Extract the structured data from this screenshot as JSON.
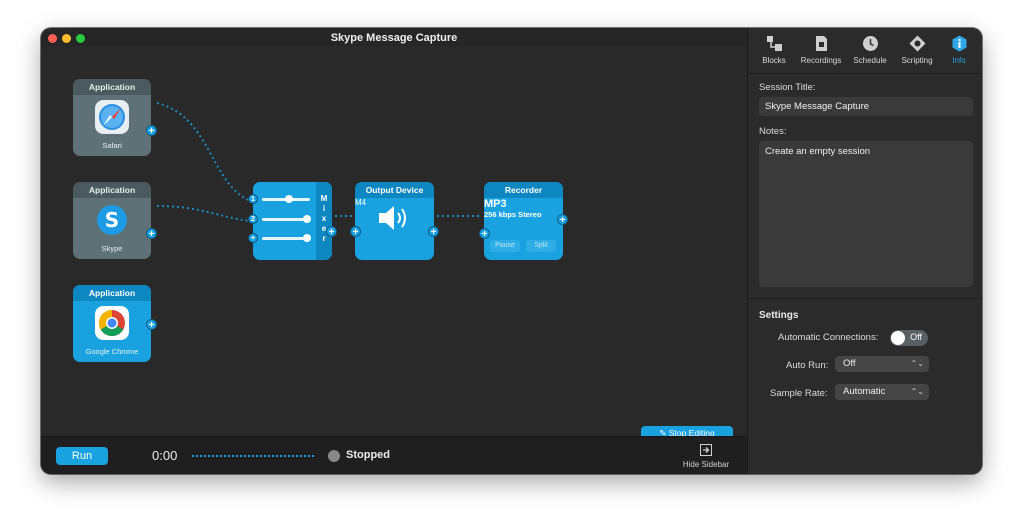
{
  "window": {
    "title": "Skype Message Capture"
  },
  "canvas": {
    "sources": [
      {
        "header": "Application",
        "name": "Safari",
        "icon": "safari-icon"
      },
      {
        "header": "Application",
        "name": "Skype",
        "icon": "skype-icon"
      },
      {
        "header": "Application",
        "name": "Google Chrome",
        "icon": "chrome-icon"
      }
    ],
    "mixer": {
      "letters": [
        "M",
        "i",
        "x",
        "e",
        "r"
      ],
      "inputs": [
        "1",
        "2",
        "+"
      ]
    },
    "output": {
      "header": "Output Device",
      "name": "M4",
      "icon": "speaker-icon"
    },
    "recorder": {
      "header": "Recorder",
      "format": "MP3",
      "quality": "256 kbps Stereo",
      "pause_label": "Pause",
      "split_label": "Split"
    },
    "stop_editing_label": "Stop Editing"
  },
  "bottom": {
    "run_label": "Run",
    "time": "0:00",
    "status": "Stopped",
    "hide_sidebar_label": "Hide Sidebar"
  },
  "sidebar": {
    "tabs": [
      {
        "label": "Blocks",
        "icon": "blocks-icon"
      },
      {
        "label": "Recordings",
        "icon": "recordings-icon"
      },
      {
        "label": "Schedule",
        "icon": "clock-icon"
      },
      {
        "label": "Scripting",
        "icon": "scripting-icon"
      },
      {
        "label": "Info",
        "icon": "info-icon",
        "active": true
      }
    ],
    "session_title_label": "Session Title:",
    "session_title_value": "Skype Message Capture",
    "notes_label": "Notes:",
    "notes_value": "Create an empty session",
    "settings_title": "Settings",
    "auto_connections_label": "Automatic Connections:",
    "auto_connections_value": "Off",
    "auto_run_label": "Auto Run:",
    "auto_run_value": "Off",
    "sample_rate_label": "Sample Rate:",
    "sample_rate_value": "Automatic"
  },
  "colors": {
    "accent": "#1aa2e0",
    "accent_dark": "#0e86c0",
    "background": "#262626"
  }
}
